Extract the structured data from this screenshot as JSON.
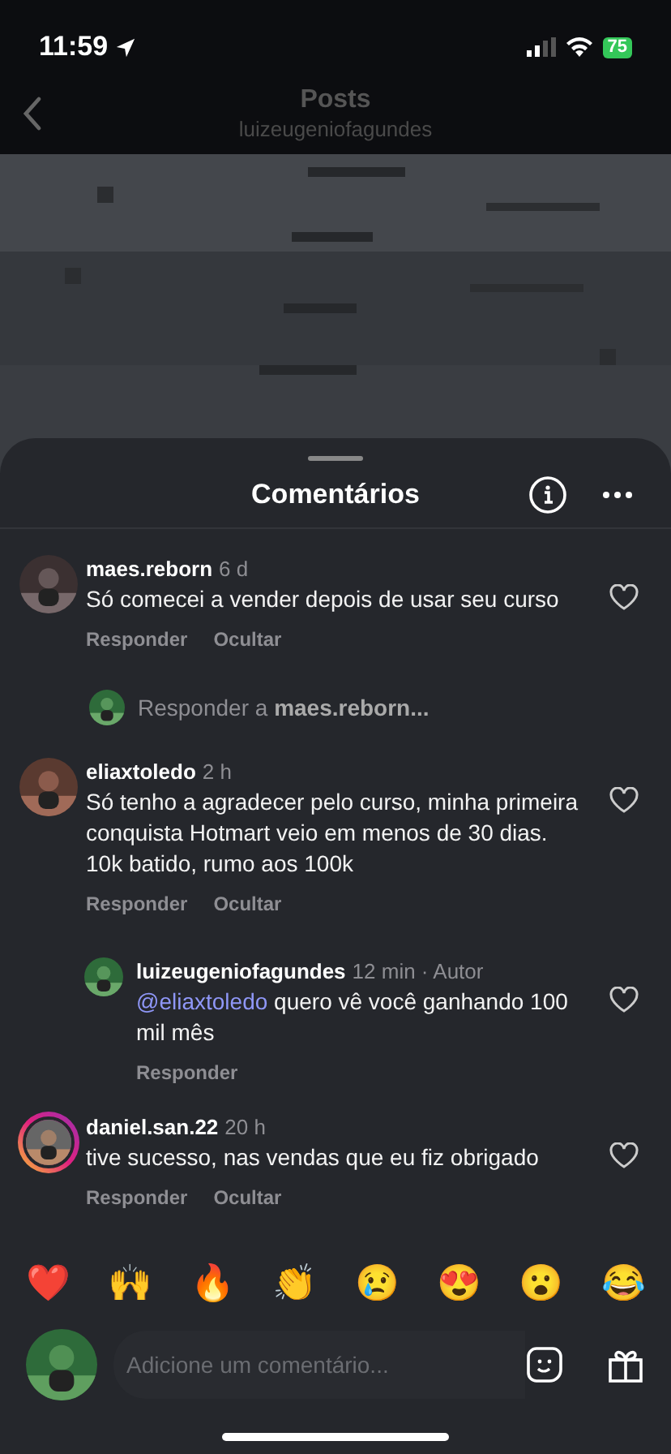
{
  "status_bar": {
    "time": "11:59",
    "battery": "75"
  },
  "header": {
    "title": "Posts",
    "subtitle": "luizeugeniofagundes"
  },
  "sheet": {
    "title": "Comentários"
  },
  "comments": [
    {
      "username": "maes.reborn",
      "time": "6 d",
      "text": "Só comecei a vender depois de usar seu curso",
      "actions": [
        "Responder",
        "Ocultar"
      ],
      "has_story": false,
      "reply_prompt": {
        "prefix": "Responder a ",
        "username": "maes.reborn..."
      }
    },
    {
      "username": "eliaxtoledo",
      "time": "2 h",
      "text": "Só tenho a agradecer pelo curso, minha primeira conquista Hotmart veio em menos de 30 dias. 10k batido, rumo aos 100k",
      "actions": [
        "Responder",
        "Ocultar"
      ],
      "has_story": false,
      "replies": [
        {
          "username": "luizeugeniofagundes",
          "meta": "12 min · Autor",
          "mention": "@eliaxtoledo",
          "text": "quero vê você ganhando 100 mil mês",
          "actions": [
            "Responder"
          ]
        }
      ]
    },
    {
      "username": "daniel.san.22",
      "time": "20 h",
      "text": "tive sucesso, nas vendas que eu fiz obrigado",
      "actions": [
        "Responder",
        "Ocultar"
      ],
      "has_story": true
    }
  ],
  "reactions": [
    "❤️",
    "🙌",
    "🔥",
    "👏",
    "😢",
    "😍",
    "😮",
    "😂"
  ],
  "composer": {
    "placeholder": "Adicione um comentário..."
  }
}
